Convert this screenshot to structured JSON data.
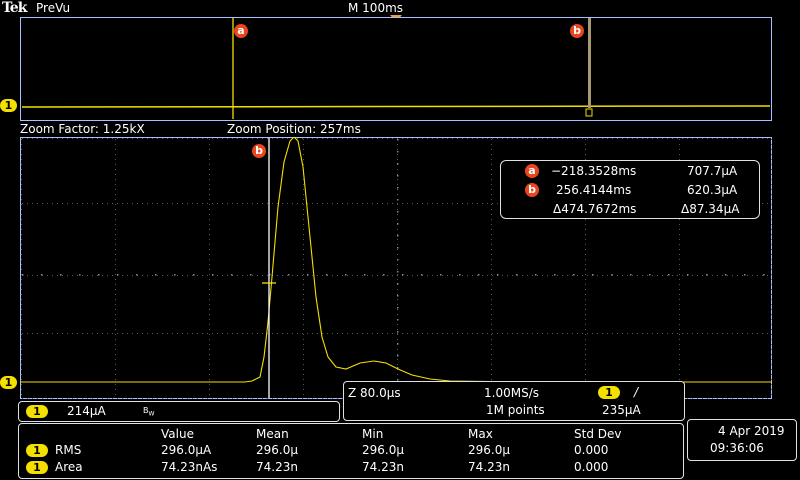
{
  "header": {
    "logo": "Tek",
    "mode": "PreVu",
    "timebase": "M 100ms"
  },
  "colors": {
    "trace": "#f4e000",
    "cursor_badge": "#e8461e",
    "grid": "#6a6a6a",
    "border": "#a8c0ff"
  },
  "overview": {
    "cursor_a_label": "a",
    "cursor_b_label": "b",
    "ch_marker": "1"
  },
  "zoom_info": {
    "factor": "Zoom Factor: 1.25kX",
    "position": "Zoom Position: 257ms"
  },
  "zoom": {
    "cursor_b_label": "b",
    "ch_marker": "1"
  },
  "cursor_readout": {
    "a_label": "a",
    "a_time": "−218.3528ms",
    "a_value": "707.7μA",
    "b_label": "b",
    "b_time": "256.4144ms",
    "b_value": "620.3μA",
    "delta_time": "Δ474.7672ms",
    "delta_value": "Δ87.34μA"
  },
  "channel_box": {
    "ch": "1",
    "scale": "214μA",
    "bw_icon": "B_W"
  },
  "acq_box": {
    "zoom_scale": "Z 80.0μs",
    "sample_rate": "1.00MS/s",
    "record_length": "1M points",
    "trig_ch": "1",
    "trig_slope": "/",
    "trig_level": "235μA"
  },
  "measurements": {
    "headers": [
      "Value",
      "Mean",
      "Min",
      "Max",
      "Std Dev"
    ],
    "rows": [
      {
        "ch": "1",
        "name": "RMS",
        "cells": [
          "296.0μA",
          "296.0μ",
          "296.0μ",
          "296.0μ",
          "0.000"
        ]
      },
      {
        "ch": "1",
        "name": "Area",
        "cells": [
          "74.23nAs",
          "74.23n",
          "74.23n",
          "74.23n",
          "0.000"
        ]
      }
    ]
  },
  "datetime": {
    "date": "4 Apr  2019",
    "time": "09:36:06"
  }
}
